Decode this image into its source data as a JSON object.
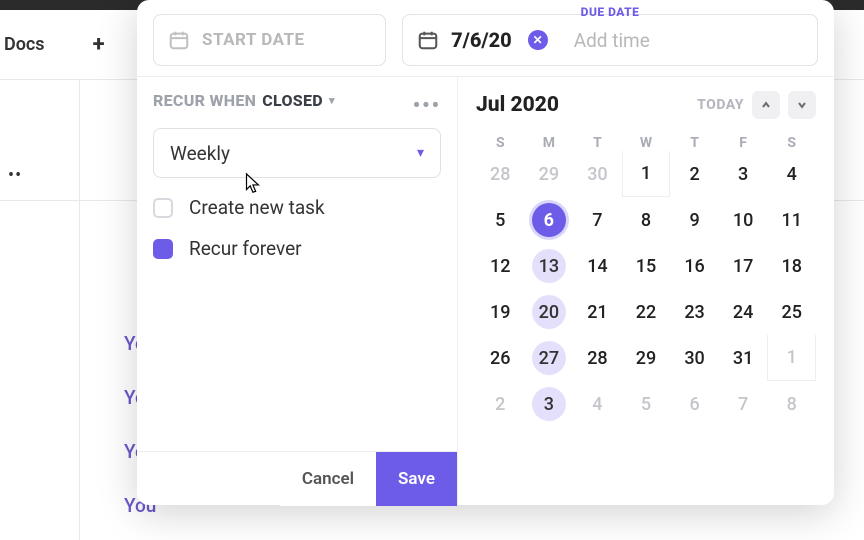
{
  "background": {
    "docs_label": "Docs",
    "plus": "+",
    "dots": "••",
    "links": [
      "Yo",
      "Yo",
      "Yo",
      "You"
    ]
  },
  "header": {
    "start_placeholder": "START DATE",
    "due_label": "DUE DATE",
    "due_value": "7/6/20",
    "add_time": "Add time"
  },
  "recur": {
    "label_prefix": "RECUR WHEN",
    "label_state": "CLOSED",
    "frequency": "Weekly",
    "dots": "•••",
    "options": [
      {
        "label": "Create new task",
        "checked": false
      },
      {
        "label": "Recur forever",
        "checked": true
      }
    ]
  },
  "calendar": {
    "title": "Jul 2020",
    "today_label": "TODAY",
    "dow": [
      "S",
      "M",
      "T",
      "W",
      "T",
      "F",
      "S"
    ],
    "weeks": [
      [
        {
          "n": "28",
          "muted": true
        },
        {
          "n": "29",
          "muted": true
        },
        {
          "n": "30",
          "muted": true
        },
        {
          "n": "1",
          "boxed": true
        },
        {
          "n": "2"
        },
        {
          "n": "3"
        },
        {
          "n": "4"
        }
      ],
      [
        {
          "n": "5"
        },
        {
          "n": "6",
          "sel": true
        },
        {
          "n": "7"
        },
        {
          "n": "8"
        },
        {
          "n": "9"
        },
        {
          "n": "10"
        },
        {
          "n": "11"
        }
      ],
      [
        {
          "n": "12"
        },
        {
          "n": "13",
          "hl": true
        },
        {
          "n": "14"
        },
        {
          "n": "15"
        },
        {
          "n": "16"
        },
        {
          "n": "17"
        },
        {
          "n": "18"
        }
      ],
      [
        {
          "n": "19"
        },
        {
          "n": "20",
          "hl": true
        },
        {
          "n": "21"
        },
        {
          "n": "22"
        },
        {
          "n": "23"
        },
        {
          "n": "24"
        },
        {
          "n": "25"
        }
      ],
      [
        {
          "n": "26"
        },
        {
          "n": "27",
          "hl": true
        },
        {
          "n": "28"
        },
        {
          "n": "29"
        },
        {
          "n": "30"
        },
        {
          "n": "31"
        },
        {
          "n": "1",
          "muted": true,
          "boxed": true
        }
      ],
      [
        {
          "n": "2",
          "muted": true
        },
        {
          "n": "3",
          "muted": true,
          "hl": true
        },
        {
          "n": "4",
          "muted": true
        },
        {
          "n": "5",
          "muted": true
        },
        {
          "n": "6",
          "muted": true
        },
        {
          "n": "7",
          "muted": true
        },
        {
          "n": "8",
          "muted": true
        }
      ]
    ]
  },
  "footer": {
    "cancel": "Cancel",
    "save": "Save"
  }
}
